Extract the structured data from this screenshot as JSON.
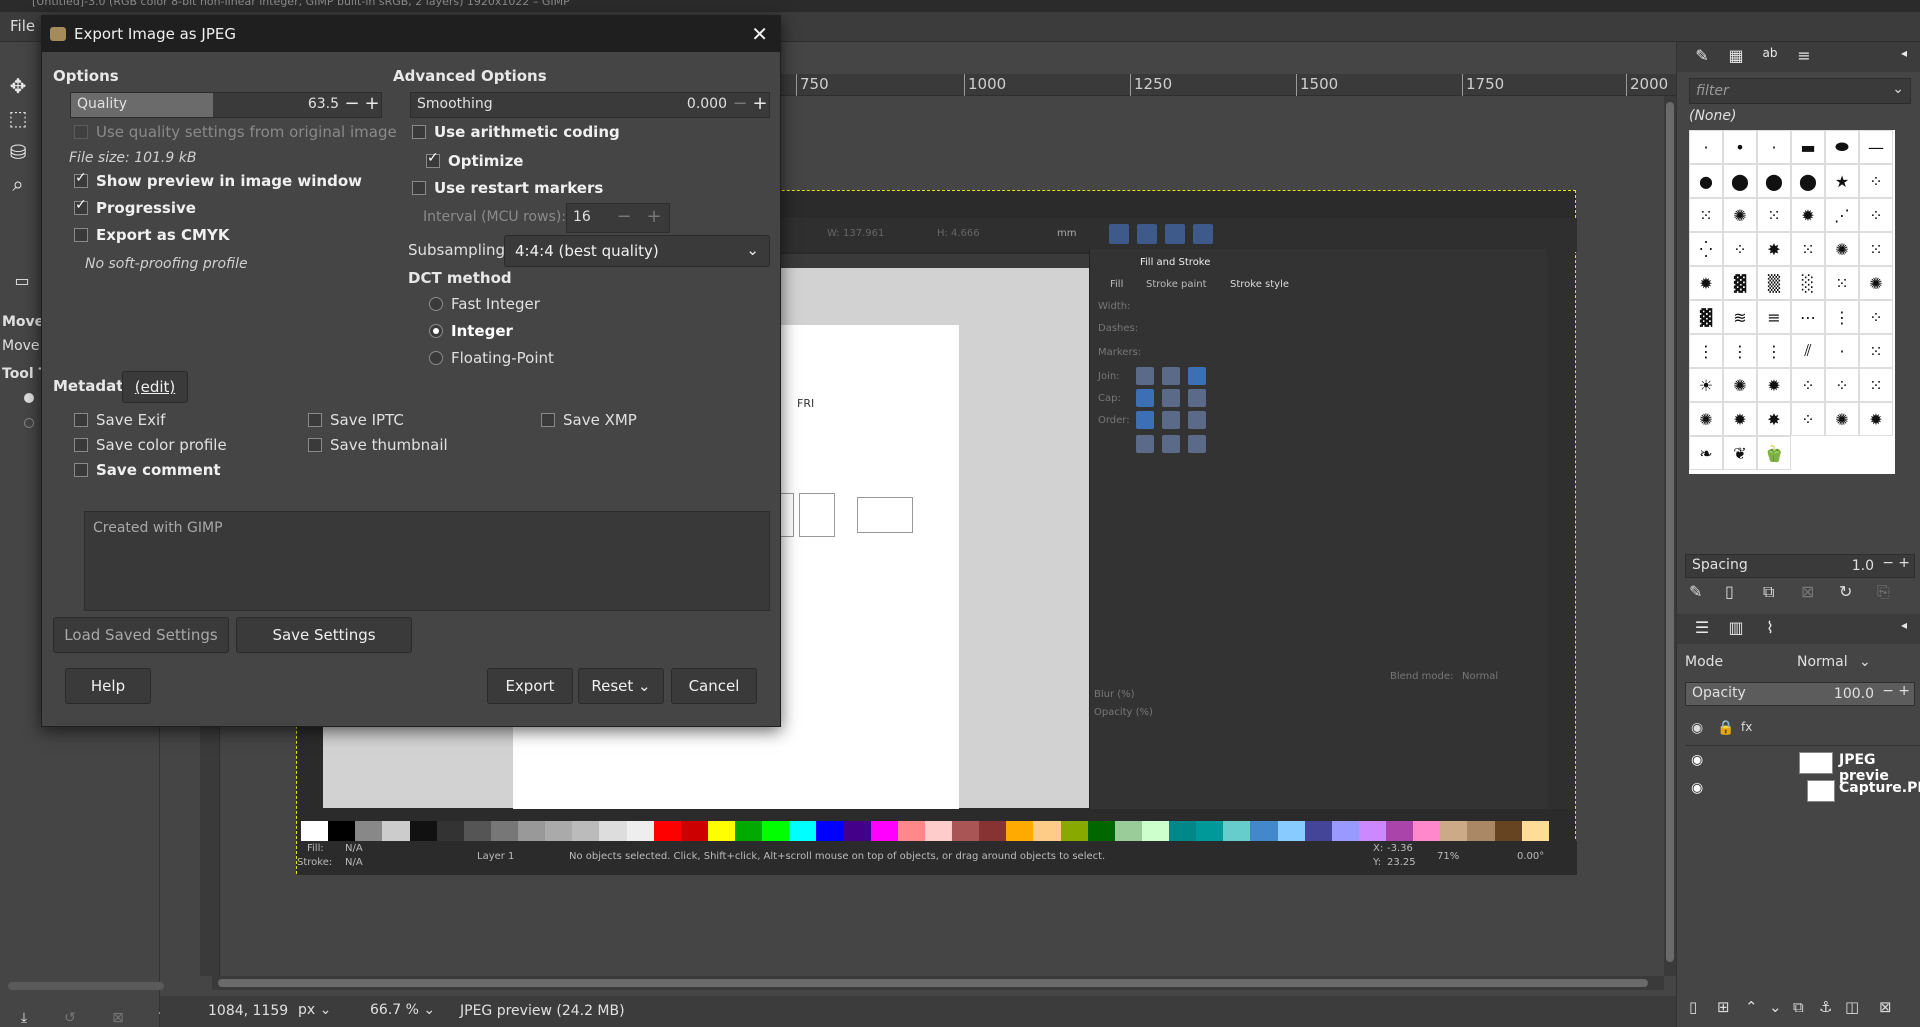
{
  "window": {
    "title": "[Untitled]-3.0 (RGB color 8-bit non-linear integer, GIMP built-in sRGB, 2 layers) 1920x1022 – GIMP"
  },
  "menu": {
    "file": "File"
  },
  "toolbox": {
    "tool_options": [
      "Move",
      "Move",
      "Tool T"
    ]
  },
  "ruler": {
    "ticks": [
      "750",
      "1000",
      "1250",
      "1500",
      "1750",
      "2000"
    ]
  },
  "preview_content": {
    "fill_stroke_tab": "Fill and Stroke",
    "fill": "Fill",
    "stroke_paint": "Stroke paint",
    "stroke_style": "Stroke style",
    "labels": [
      "Width:",
      "Dashes:",
      "Markers:",
      "Join:",
      "Cap:",
      "Order:"
    ],
    "page_text": "FRI",
    "blend_mode_label": "Blend mode:",
    "blend_mode_value": "Normal",
    "blur": "Blur (%)",
    "opacity": "Opacity (%)",
    "status": "No objects selected. Click, Shift+click, Alt+scroll mouse on top of objects, or drag around objects to select.",
    "layer": "Layer 1",
    "fill_na": "N/A",
    "stroke_na": "N/A",
    "zoom": "71%",
    "rotation": "0.00°",
    "fill_label": "Fill:",
    "stroke_label": "Stroke:",
    "w_value": "137.961",
    "h_value": "4.666",
    "unit": "mm",
    "x_label": "X:",
    "x_val": "-3.36",
    "y_label": "Y:",
    "y_val": "23.25"
  },
  "dock": {
    "filter_placeholder": "filter",
    "brush_none": "(None)",
    "spacing_label": "Spacing",
    "spacing_value": "1.0",
    "mode_label": "Mode",
    "mode_value": "Normal",
    "opacity_label": "Opacity",
    "opacity_value": "100.0",
    "layers": [
      {
        "name": "JPEG previe"
      },
      {
        "name": "Capture.PN"
      }
    ]
  },
  "statusbar": {
    "coords": "1084, 1159",
    "unit": "px",
    "zoom": "66.7 %",
    "layer_info": "JPEG preview (24.2 MB)"
  },
  "dialog": {
    "title": "Export Image as JPEG",
    "options_heading": "Options",
    "quality_label": "Quality",
    "quality_value": "63.5",
    "quality_fraction": 0.635,
    "use_quality_original": "Use quality settings from original image",
    "file_size": "File size: 101.9 kB",
    "show_preview": "Show preview in image window",
    "progressive": "Progressive",
    "export_cmyk": "Export as CMYK",
    "no_softproof": "No soft-proofing profile",
    "advanced_heading": "Advanced Options",
    "smoothing_label": "Smoothing",
    "smoothing_value": "0.000",
    "arithmetic": "Use arithmetic coding",
    "optimize": "Optimize",
    "restart_markers": "Use restart markers",
    "interval_label": "Interval (MCU rows):",
    "interval_value": "16",
    "subsampling_label": "Subsampling",
    "subsampling_value": "4:4:4 (best quality)",
    "dct_heading": "DCT method",
    "dct_options": [
      "Fast Integer",
      "Integer",
      "Floating-Point"
    ],
    "dct_selected": "Integer",
    "metadata_heading": "Metadata",
    "edit_link": "(edit)",
    "save_exif": "Save Exif",
    "save_iptc": "Save IPTC",
    "save_xmp": "Save XMP",
    "save_color_profile": "Save color profile",
    "save_thumbnail": "Save thumbnail",
    "save_comment": "Save comment",
    "comment_text": "Created with GIMP",
    "load_saved": "Load Saved Settings",
    "save_settings": "Save Settings",
    "help": "Help",
    "export": "Export",
    "reset": "Reset",
    "cancel": "Cancel"
  },
  "colors": {
    "dialog_bg": "#454545",
    "titlebar": "#1f1f1f",
    "quality_fill": "#6b6b6b",
    "selection_dash": "#e6e600"
  }
}
